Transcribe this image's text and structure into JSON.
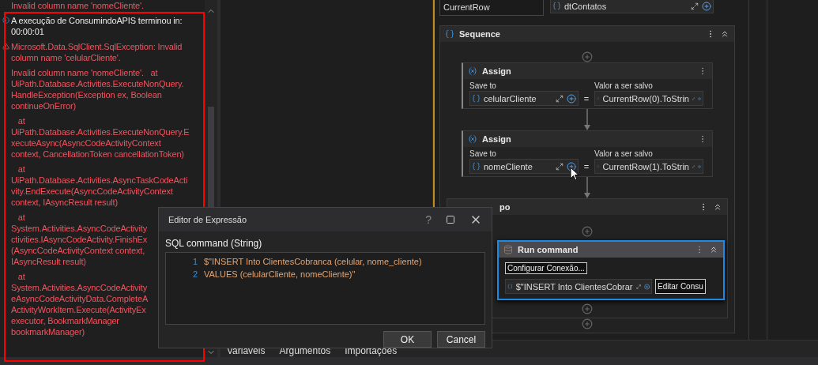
{
  "output_log": [
    {
      "kind": "detail",
      "lines": [
        "Invalid column name 'nomeCliente'."
      ]
    },
    {
      "kind": "info",
      "lines": [
        "A execução de ConsumindoAPIS terminou in:",
        "00:00:01"
      ]
    },
    {
      "kind": "error",
      "lines": [
        "Microsoft.Data.SqlClient.SqlException: Invalid",
        "column name 'celularCliente'."
      ]
    },
    {
      "kind": "detail",
      "lines": [
        "Invalid column name 'nomeCliente'.   at",
        "UiPath.Database.Activities.ExecuteNonQuery.",
        "HandleException(Exception ex, Boolean",
        "continueOnError)"
      ]
    },
    {
      "kind": "detail",
      "lines": [
        "   at",
        "UiPath.Database.Activities.ExecuteNonQuery.E",
        "xecuteAsync(AsyncCodeActivityContext",
        "context, CancellationToken cancellationToken)"
      ]
    },
    {
      "kind": "detail",
      "lines": [
        "   at",
        "UiPath.Database.Activities.AsyncTaskCodeActi",
        "vity.EndExecute(AsyncCodeActivityContext",
        "context, IAsyncResult result)"
      ]
    },
    {
      "kind": "detail",
      "lines": [
        "   at",
        "System.Activities.AsyncCodeActivity",
        "ctivities.IAsyncCodeActivity.FinishEx",
        "(AsyncCodeActivityContext context,",
        "IAsyncResult result)"
      ]
    },
    {
      "kind": "detail",
      "lines": [
        "   at",
        "System.Activities.AsyncCodeActivity",
        "eAsyncCodeActivityData.CompleteA",
        "ActivityWorkItem.Execute(ActivityEx",
        "executor, BookmarkManager",
        "bookmarkManager)"
      ]
    }
  ],
  "designer": {
    "item": "CurrentRow",
    "collection": "dtContatos",
    "sequence": {
      "title": "Sequence",
      "assigns": [
        {
          "title": "Assign",
          "save_to_label": "Save to",
          "value_label": "Valor a ser salvo",
          "save_to": "celularCliente",
          "operator": "=",
          "value": "CurrentRow(0).ToStrin"
        },
        {
          "title": "Assign",
          "save_to_label": "Save to",
          "value_label": "Valor a ser salvo",
          "save_to": "nomeCliente",
          "operator": "=",
          "value": "CurrentRow(1).ToStrin"
        }
      ],
      "body": {
        "title": "po",
        "run_command": {
          "title": "Run command",
          "selected": true,
          "connection_button": "Configurar Conexão...",
          "sql": "$\"INSERT Into ClientesCobrar",
          "edit_button": "Editar Consu"
        }
      }
    }
  },
  "bottom_tabs": [
    "Variáveis",
    "Argumentos",
    "Importações"
  ],
  "dialog": {
    "title": "Editor de Expressão",
    "help": "?",
    "field_label": "SQL command (String)",
    "code_lines": [
      {
        "number": "1",
        "text": "$\"INSERT Into ClientesCobranca (celular, nome_cliente)"
      },
      {
        "number": "2",
        "text": "VALUES (celularCliente, nomeCliente)\""
      }
    ],
    "buttons": [
      "OK",
      "Cancel"
    ]
  }
}
